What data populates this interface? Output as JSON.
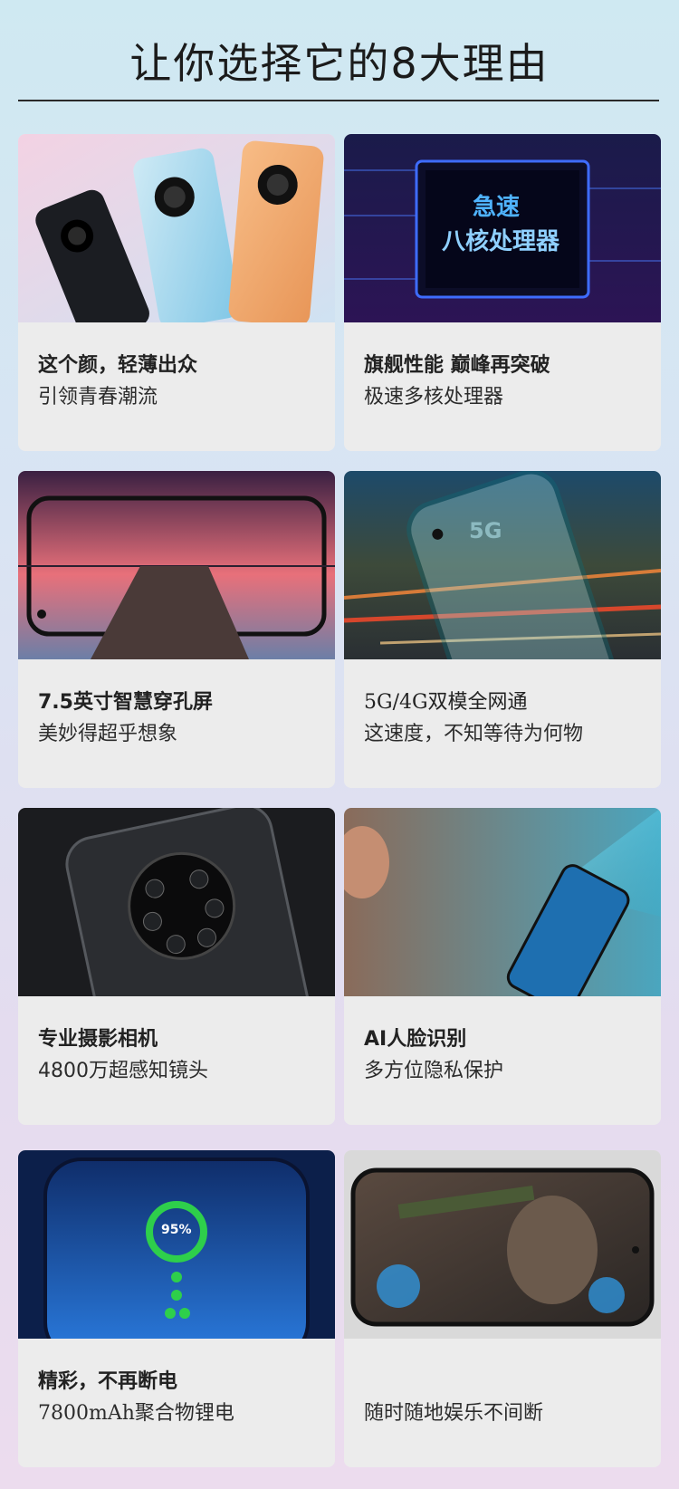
{
  "page": {
    "title": "让你选择它的8大理由"
  },
  "cards": [
    {
      "line1": "这个颜，轻薄出众",
      "line2": "引领青春潮流"
    },
    {
      "line1": "旗舰性能  巅峰再突破",
      "line2": "极速多核处理器",
      "overlay_line1": "急速",
      "overlay_line2": "八核处理器"
    },
    {
      "line1": "7.5英寸智慧穿孔屏",
      "line2": "美妙得超乎想象"
    },
    {
      "line1": "5G/4G双模全网通",
      "line2": "这速度，不知等待为何物",
      "overlay_badge": "5G"
    },
    {
      "line1": "专业摄影相机",
      "line2": "4800万超感知镜头"
    },
    {
      "line1": "AI人脸识别",
      "line2": "多方位隐私保护"
    },
    {
      "line1": "精彩，不再断电",
      "line2": "7800mAh聚合物锂电",
      "overlay_percent": "95%"
    },
    {
      "line1": "",
      "line2": "随时随地娱乐不间断"
    }
  ],
  "colors": {
    "accent_blue": "#1e63d6",
    "chip_text": "#4fb3ff",
    "battery_green": "#2ecf4b",
    "phone_orange": "#f0a76b",
    "phone_blue": "#9fd6ea"
  }
}
